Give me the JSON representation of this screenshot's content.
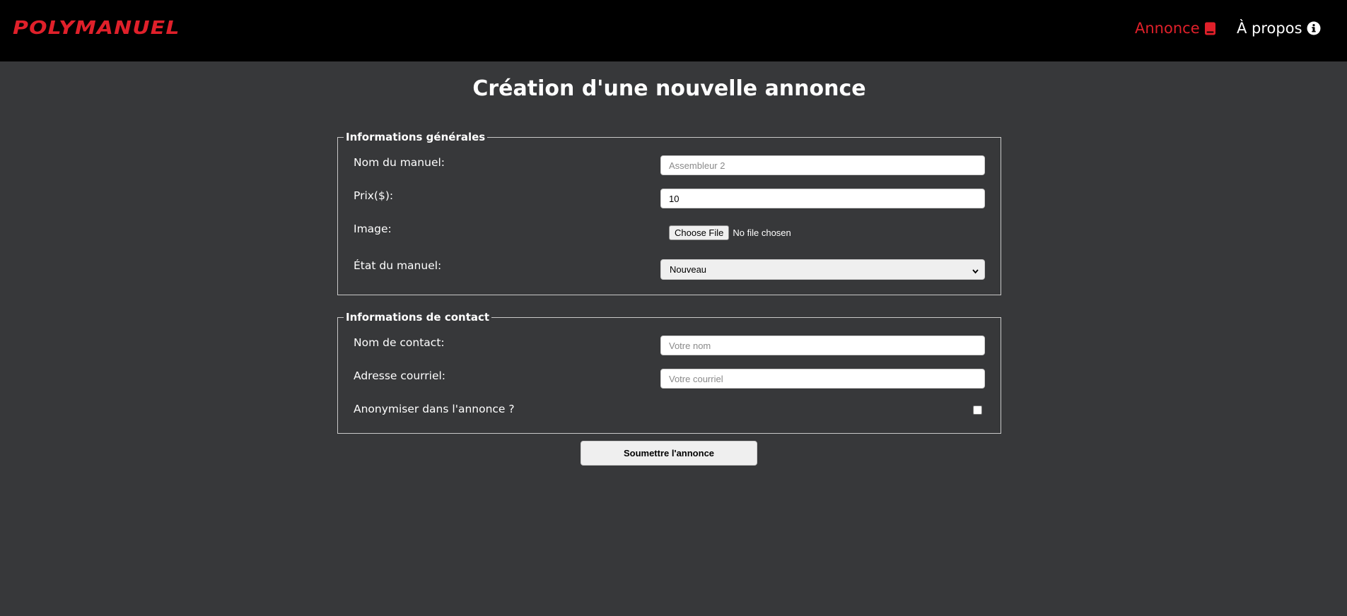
{
  "header": {
    "logo": "POLYMANUEL",
    "nav": {
      "annonce": "Annonce",
      "apropos": "À propos"
    },
    "accent_color": "#e0202a"
  },
  "page": {
    "title": "Création d'une nouvelle annonce"
  },
  "general": {
    "legend": "Informations générales",
    "nom_label": "Nom du manuel:",
    "nom_placeholder": "Assembleur 2",
    "prix_label": "Prix($):",
    "prix_value": "10",
    "image_label": "Image:",
    "file_button": "Choose File",
    "file_status": "No file chosen",
    "etat_label": "État du manuel:",
    "etat_selected": "Nouveau"
  },
  "contact": {
    "legend": "Informations de contact",
    "nom_label": "Nom de contact:",
    "nom_placeholder": "Votre nom",
    "email_label": "Adresse courriel:",
    "email_placeholder": "Votre courriel",
    "anon_label": "Anonymiser dans l'annonce ?",
    "anon_checked": false
  },
  "submit_label": "Soumettre l'annonce",
  "icons": {
    "annonce": "book-icon",
    "apropos": "info-icon"
  }
}
